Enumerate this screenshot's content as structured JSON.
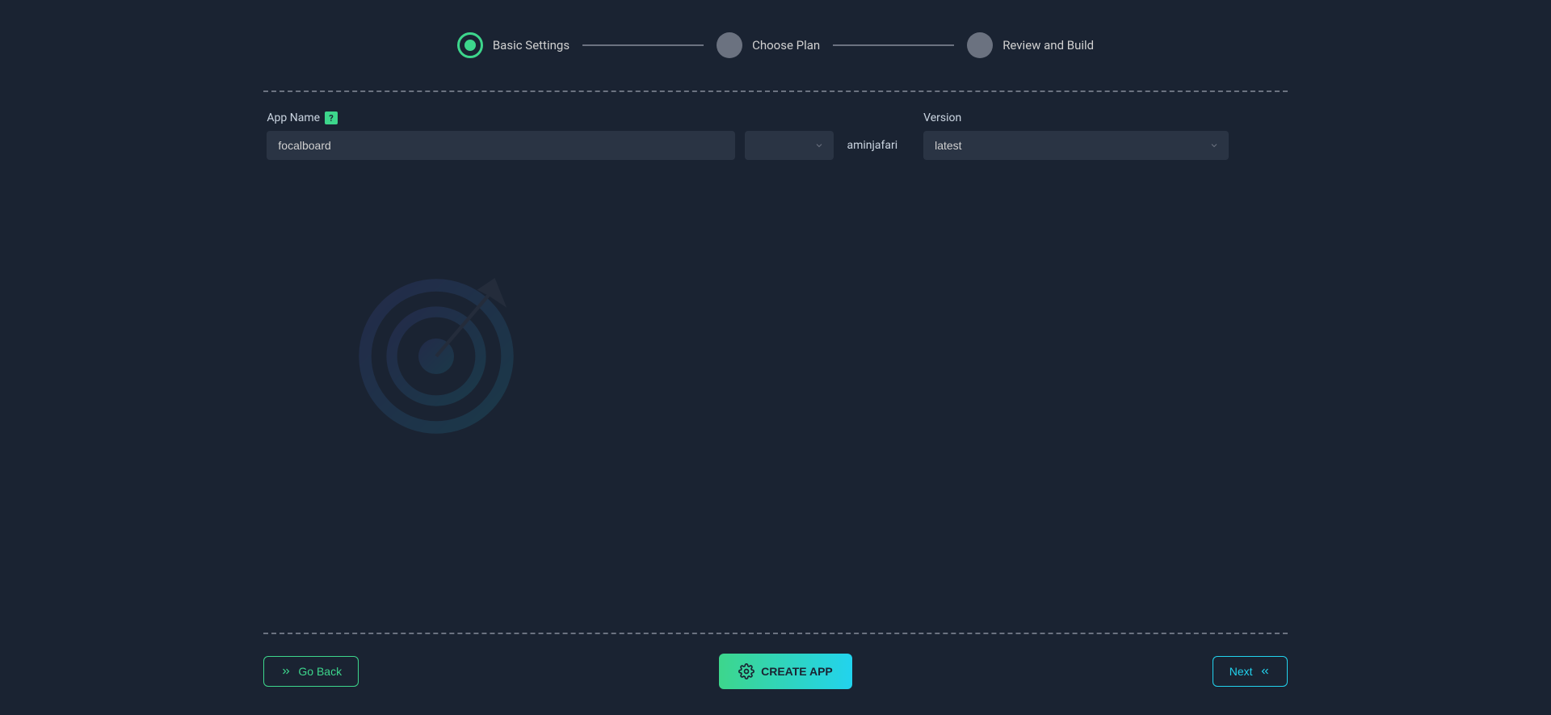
{
  "stepper": {
    "steps": [
      {
        "label": "Basic Settings",
        "state": "active"
      },
      {
        "label": "Choose Plan",
        "state": "inactive"
      },
      {
        "label": "Review and Build",
        "state": "inactive"
      }
    ]
  },
  "form": {
    "appName": {
      "label": "App Name",
      "value": "focalboard",
      "helpIcon": "?",
      "suffixSelectValue": "",
      "suffixText": "aminjafari"
    },
    "version": {
      "label": "Version",
      "value": "latest"
    }
  },
  "footer": {
    "goBack": "Go Back",
    "createApp": "CREATE APP",
    "next": "Next"
  },
  "colors": {
    "background": "#1a2332",
    "accent_green": "#3dd68c",
    "accent_cyan": "#22d3ee",
    "input_bg": "#2a3444",
    "muted": "#6b7280"
  }
}
